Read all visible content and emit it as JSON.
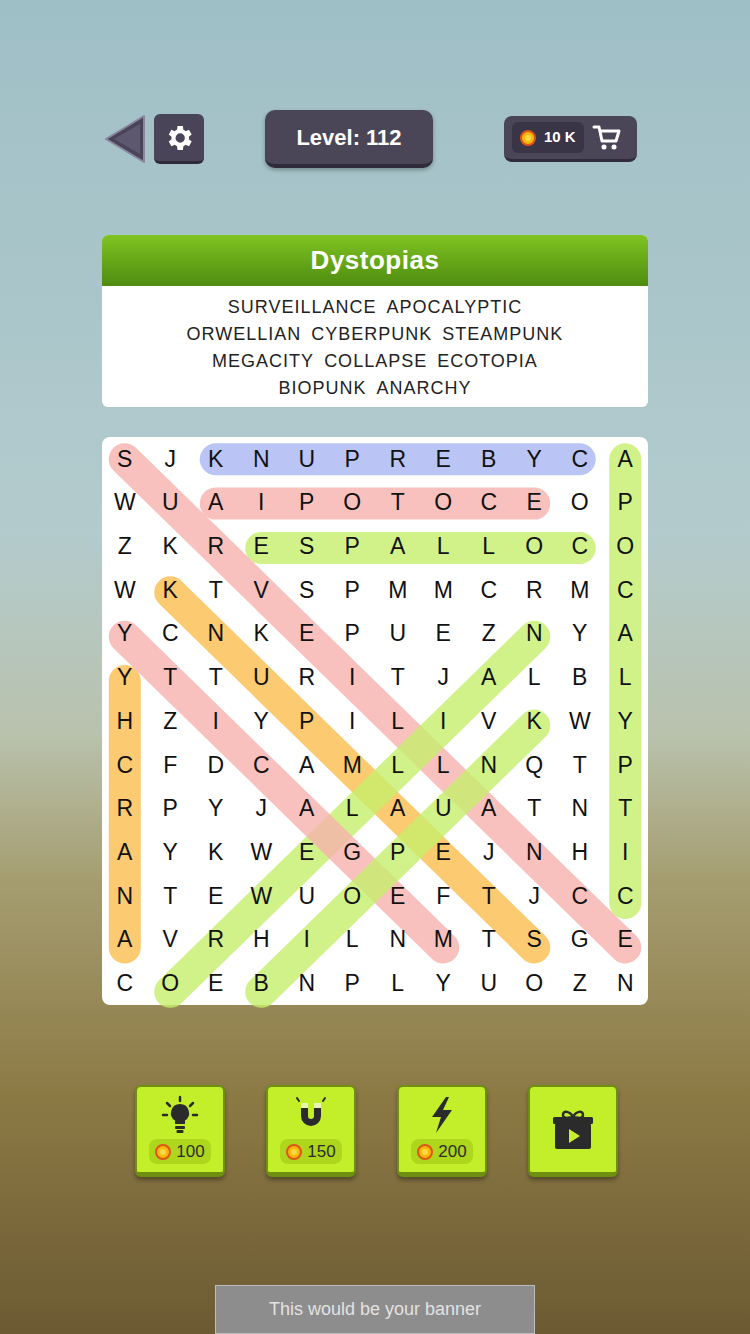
{
  "top_bar": {
    "level": "Level: 112",
    "coins": "10 K"
  },
  "category": {
    "title": "Dystopias",
    "word_lines": [
      [
        "SURVEILLANCE",
        "APOCALYPTIC"
      ],
      [
        "ORWELLIAN",
        "CYBERPUNK",
        "STEAMPUNK"
      ],
      [
        "MEGACITY",
        "COLLAPSE",
        "ECOTOPIA"
      ],
      [
        "BIOPUNK",
        "ANARCHY"
      ]
    ]
  },
  "grid": {
    "rows": [
      [
        "S",
        "J",
        "K",
        "N",
        "U",
        "P",
        "R",
        "E",
        "B",
        "Y",
        "C",
        "A"
      ],
      [
        "W",
        "U",
        "A",
        "I",
        "P",
        "O",
        "T",
        "O",
        "C",
        "E",
        "O",
        "P"
      ],
      [
        "Z",
        "K",
        "R",
        "E",
        "S",
        "P",
        "A",
        "L",
        "L",
        "O",
        "C",
        "O"
      ],
      [
        "W",
        "K",
        "T",
        "V",
        "S",
        "P",
        "M",
        "M",
        "C",
        "R",
        "M",
        "C"
      ],
      [
        "Y",
        "C",
        "N",
        "K",
        "E",
        "P",
        "U",
        "E",
        "Z",
        "N",
        "Y",
        "A"
      ],
      [
        "Y",
        "T",
        "T",
        "U",
        "R",
        "I",
        "T",
        "J",
        "A",
        "L",
        "B",
        "L"
      ],
      [
        "H",
        "Z",
        "I",
        "Y",
        "P",
        "I",
        "L",
        "I",
        "V",
        "K",
        "W",
        "Y"
      ],
      [
        "C",
        "F",
        "D",
        "C",
        "A",
        "M",
        "L",
        "L",
        "N",
        "Q",
        "T",
        "P"
      ],
      [
        "R",
        "P",
        "Y",
        "J",
        "A",
        "L",
        "A",
        "U",
        "A",
        "T",
        "N",
        "T"
      ],
      [
        "A",
        "Y",
        "K",
        "W",
        "E",
        "G",
        "P",
        "E",
        "J",
        "N",
        "H",
        "I"
      ],
      [
        "N",
        "T",
        "E",
        "W",
        "U",
        "O",
        "E",
        "F",
        "T",
        "J",
        "C",
        "C"
      ],
      [
        "A",
        "V",
        "R",
        "H",
        "I",
        "L",
        "N",
        "M",
        "T",
        "S",
        "G",
        "E"
      ],
      [
        "C",
        "O",
        "E",
        "B",
        "N",
        "P",
        "L",
        "Y",
        "U",
        "O",
        "Z",
        "N"
      ]
    ]
  },
  "highlights": [
    {
      "start": [
        0,
        2
      ],
      "end": [
        0,
        10
      ],
      "color": "#a9b6f2"
    },
    {
      "start": [
        1,
        2
      ],
      "end": [
        1,
        9
      ],
      "color": "#f6b1ad"
    },
    {
      "start": [
        2,
        3
      ],
      "end": [
        2,
        10
      ],
      "color": "#c6ef6b"
    },
    {
      "start": [
        0,
        11
      ],
      "end": [
        10,
        11
      ],
      "color": "#c6ef6b"
    },
    {
      "start": [
        5,
        0
      ],
      "end": [
        11,
        0
      ],
      "color": "#fbbd4c"
    },
    {
      "start": [
        0,
        0
      ],
      "end": [
        11,
        11
      ],
      "color": "#f6b1ad"
    },
    {
      "start": [
        3,
        1
      ],
      "end": [
        11,
        9
      ],
      "color": "#fbbd4c"
    },
    {
      "start": [
        4,
        9
      ],
      "end": [
        12,
        1
      ],
      "color": "#c6ef6b"
    },
    {
      "start": [
        4,
        0
      ],
      "end": [
        11,
        7
      ],
      "color": "#f6b1ad"
    },
    {
      "start": [
        6,
        9
      ],
      "end": [
        12,
        3
      ],
      "color": "#c6ef6b"
    }
  ],
  "boosters": [
    {
      "kind": "hint",
      "price": "100"
    },
    {
      "kind": "magnet",
      "price": "150"
    },
    {
      "kind": "lightning",
      "price": "200"
    },
    {
      "kind": "video-gift"
    }
  ],
  "banner": "This would be your banner"
}
